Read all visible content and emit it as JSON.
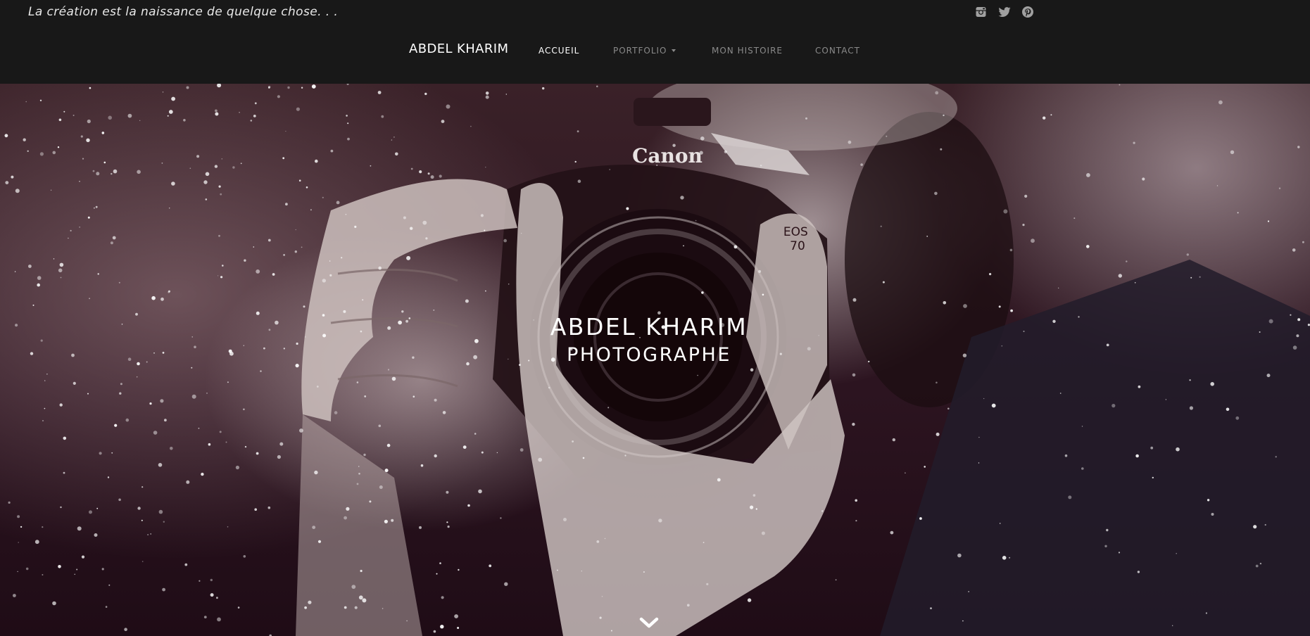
{
  "header": {
    "tagline": "La création est la naissance de quelque chose. . .",
    "brand": "ABDEL KHARIM",
    "social": [
      {
        "icon": "instagram-icon"
      },
      {
        "icon": "twitter-icon"
      },
      {
        "icon": "pinterest-icon"
      }
    ],
    "nav": [
      {
        "label": "ACCUEIL",
        "active": true
      },
      {
        "label": "PORTFOLIO",
        "has_dropdown": true
      },
      {
        "label": "MON HISTOIRE"
      },
      {
        "label": "CONTACT"
      }
    ]
  },
  "hero": {
    "title": "ABDEL KHARIM",
    "subtitle": "PHOTOGRAPHE",
    "camera_brand": "Canon",
    "camera_model": "EOS\n70",
    "scroll_icon": "chevron-down-icon"
  },
  "colors": {
    "header_bg": "#181818",
    "nav_active": "#ffffff",
    "nav_inactive": "#8a8a8a",
    "social_icon": "#a0a0a0",
    "hero_tint": "#2c1420"
  }
}
